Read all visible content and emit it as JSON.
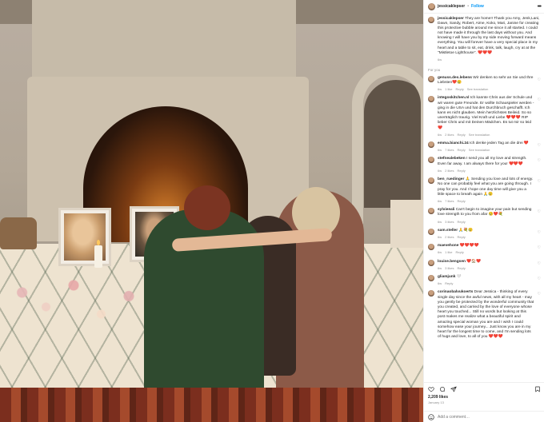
{
  "header": {
    "username": "jessicaklepser",
    "separator": "•",
    "follow_label": "Follow",
    "more_icon": "ellipsis-icon"
  },
  "caption": {
    "username": "jessicaklepser",
    "text": "They are home!! Thank you Amy, Jenk,Lani, Dawn, Sandy, Robert, Aime, Koko, Mari, Janine for creating this protective bubble around me since it all started. I could not have made it through the last days without you. And knowing I will have you by my side moving forward means everything. You will forever have a very special place in my heart and a table to sit, eat, drink, talk, laugh, cry at at the \"Mistletoe Lighthouse\". ❤️❤️❤️",
    "time": "6w"
  },
  "for_you_label": "For you",
  "comments": [
    {
      "user": "genuss.des.lebens",
      "text": "Wir denken so sehr an Sie und Ihre Liebsten❤️😢",
      "meta": [
        "6w",
        "1 like",
        "Reply",
        "See translation"
      ]
    },
    {
      "user": "integoskitchen.nl",
      "text": "Ich kannte Chris aus der Schule und wir waren gute Freunde. Er wollte Schauspieler werden - ging in die USA und hat den Durchbruch geschafft. Ich kann es nicht glauben. Mein herzlichstes Beileid. So so unerträglich traurig. Viel Kraft und Liebe ❤️❤️❤️ RIP lieber Chris und mit Deinen Mädchen. Es tut mir so leid ❤️",
      "meta": [
        "6w",
        "2 likes",
        "Reply",
        "See translation"
      ]
    },
    {
      "user": "emma.bianchi.24",
      "text": "Ich denke jeden Tag an die drei ❤️",
      "meta": [
        "6w",
        "7 likes",
        "Reply",
        "See translation"
      ]
    },
    {
      "user": "stefnealebeken",
      "text": "I send you all my love and strength. Even far away. I am always there for you! ❤️❤️❤️",
      "meta": [
        "6w",
        "2 likes",
        "Reply"
      ]
    },
    {
      "user": "ben_ruedinger",
      "text": "🙏 Sending you love and lots of energy. No one can probably feel what you are going through. I pray for you. And I hope one day time will give you a little space to breath again 🙏😢",
      "meta": [
        "6w",
        "7 likes",
        "Reply"
      ]
    },
    {
      "user": "sylvieeali",
      "text": "Can't begin to imagine your pain but sending love strength to you from afar 😢❤️💐",
      "meta": [
        "6w",
        "3 likes",
        "Reply"
      ]
    },
    {
      "user": "sam.steller",
      "text": "🙏💐😢",
      "meta": [
        "6w",
        "2 likes",
        "Reply"
      ]
    },
    {
      "user": "maevehone",
      "text": "❤️❤️❤️❤️",
      "meta": [
        "6w",
        "1 like",
        "Reply"
      ]
    },
    {
      "user": "louise.bengsen",
      "text": "❤️🏠❤️",
      "meta": [
        "6w",
        "3 likes",
        "Reply"
      ]
    },
    {
      "user": "gliamjunk",
      "text": "🤍",
      "meta": [
        "6w",
        "Reply"
      ]
    },
    {
      "user": "corinaobalvukoerts",
      "text": "Dear Jessica - thinking of every single day since the awful news, with all my heart - may you gently be protected by the wonderful community that you created, and carried by the love of everyone whose heart you touched... Still no words but looking at this post makes me realize what a beautiful spirit and amazing special woman you are and I wish I could somehow ease your journey... Just know you are in my heart for the longest time to come, and I'm sending lots of hugs and love, to all of you ❤️❤️❤️",
      "meta": []
    }
  ],
  "actions": {
    "likes": "2,209 likes",
    "date": "January 13"
  },
  "add_comment": {
    "placeholder": "Add a comment…"
  },
  "colors": {
    "accent": "#0095f6",
    "text": "#262626",
    "muted": "#8e8e8e",
    "heart": "#ed4956"
  }
}
